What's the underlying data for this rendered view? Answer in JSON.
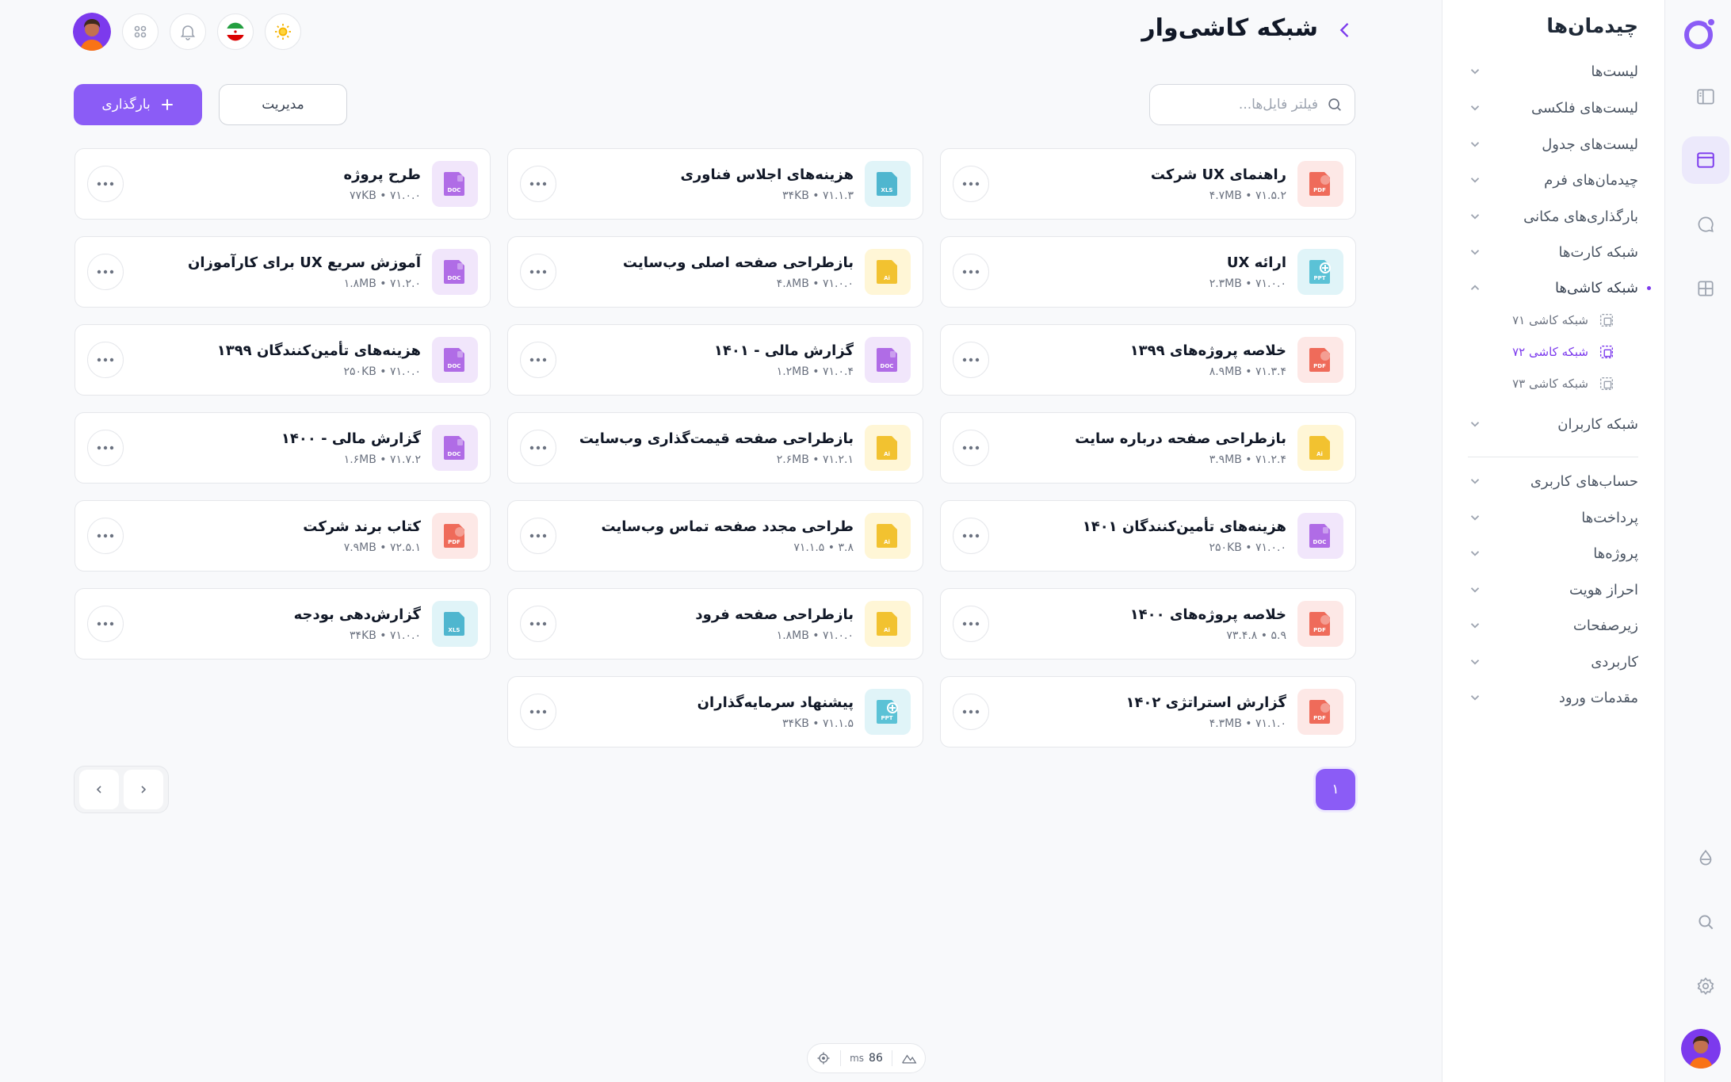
{
  "app": {
    "title": "شبکه کاشی‌وار"
  },
  "sidebar": {
    "title": "چیدمان‌ها",
    "items": [
      {
        "label": "لیست‌ها",
        "open": false
      },
      {
        "label": "لیست‌های فلکسی",
        "open": false
      },
      {
        "label": "لیست‌های جدول",
        "open": false
      },
      {
        "label": "چیدمان‌های فرم",
        "open": false
      },
      {
        "label": "بارگذاری‌های مکانی",
        "open": false
      },
      {
        "label": "شبکه کارت‌ها",
        "open": false
      },
      {
        "label": "شبکه کاشی‌ها",
        "open": true
      },
      {
        "label": "شبکه کاربران",
        "open": false
      }
    ],
    "subitems": [
      {
        "label": "شبکه کاشی ۷۱",
        "active": false
      },
      {
        "label": "شبکه کاشی ۷۲",
        "active": true
      },
      {
        "label": "شبکه کاشی ۷۳",
        "active": false
      }
    ],
    "items2": [
      {
        "label": "حساب‌های کاربری"
      },
      {
        "label": "پرداخت‌ها"
      },
      {
        "label": "پروژه‌ها"
      },
      {
        "label": "احراز هویت"
      },
      {
        "label": "زیرصفحات"
      },
      {
        "label": "کاربردی"
      },
      {
        "label": "مقدمات ورود"
      }
    ]
  },
  "toolbar": {
    "search_placeholder": "فیلتر فایل‌ها...",
    "upload_label": "بارگذاری",
    "manage_label": "مدیریت"
  },
  "files": [
    {
      "name": "راهنمای UX شرکت",
      "meta": "۴.۷MB • ۷۱.۵.۲",
      "type": "PDF"
    },
    {
      "name": "هزینه‌های اجلاس فناوری",
      "meta": "۳۴KB • ۷۱.۱.۳",
      "type": "XLS"
    },
    {
      "name": "طرح پروژه",
      "meta": "۷۷KB • ۷۱.۰.۰",
      "type": "DOC"
    },
    {
      "name": "ارائه UX",
      "meta": "۲.۳MB • ۷۱.۰.۰",
      "type": "PPT"
    },
    {
      "name": "بازطراحی صفحه اصلی وب‌سایت",
      "meta": "۴.۸MB • ۷۱.۰.۰",
      "type": "AI"
    },
    {
      "name": "آموزش سریع UX برای کارآموزان",
      "meta": "۱.۸MB • ۷۱.۲.۰",
      "type": "DOC"
    },
    {
      "name": "خلاصه پروژه‌های ۱۳۹۹",
      "meta": "۸.۹MB • ۷۱.۳.۴",
      "type": "PDF"
    },
    {
      "name": "گزارش مالی - ۱۴۰۱",
      "meta": "۱.۲MB • ۷۱.۰.۴",
      "type": "DOC"
    },
    {
      "name": "هزینه‌های تأمین‌کنندگان ۱۳۹۹",
      "meta": "۲۵۰KB • ۷۱.۰.۰",
      "type": "DOC"
    },
    {
      "name": "بازطراحی صفحه درباره سایت",
      "meta": "۳.۹MB • ۷۱.۲.۴",
      "type": "AI"
    },
    {
      "name": "بازطراحی صفحه قیمت‌گذاری وب‌سایت",
      "meta": "۲.۶MB • ۷۱.۲.۱",
      "type": "AI"
    },
    {
      "name": "گزارش مالی - ۱۴۰۰",
      "meta": "۱.۶MB • ۷۱.۷.۲",
      "type": "DOC"
    },
    {
      "name": "هزینه‌های تأمین‌کنندگان ۱۴۰۱",
      "meta": "۲۵۰KB • ۷۱.۰.۰",
      "type": "DOC"
    },
    {
      "name": "طراحی مجدد صفحه تماس وب‌سایت",
      "meta": "۳.۸ • ۷۱.۱.۵",
      "type": "AI"
    },
    {
      "name": "کتاب برند شرکت",
      "meta": "۷.۹MB • ۷۲.۵.۱",
      "type": "PDF"
    },
    {
      "name": "خلاصه پروژه‌های ۱۴۰۰",
      "meta": "۵.۹ • ۷۳.۴.۸",
      "type": "PDF"
    },
    {
      "name": "بازطراحی صفحه فرود",
      "meta": "۱.۸MB • ۷۱.۰.۰",
      "type": "AI"
    },
    {
      "name": "گزارش‌دهی بودجه",
      "meta": "۳۴KB • ۷۱.۰.۰",
      "type": "XLS"
    },
    {
      "name": "گزارش استراتژی ۱۴۰۲",
      "meta": "۴.۳MB • ۷۱.۱.۰",
      "type": "PDF"
    },
    {
      "name": "پیشنهاد سرمایه‌گذاران",
      "meta": "۳۴KB • ۷۱.۱.۵",
      "type": "PPT"
    }
  ],
  "pagination": {
    "current": "۱"
  },
  "perf": {
    "value": "86",
    "unit": "ms"
  },
  "colors": {
    "accent": "#8b5cf6",
    "pdf_bg": "#fde8e6",
    "pdf_fg": "#ef6b5a",
    "xls_bg": "#e0f4f8",
    "xls_fg": "#4fb6cf",
    "doc_bg": "#f1e6fb",
    "doc_fg": "#b06ce6",
    "ppt_bg": "#e0f4f8",
    "ppt_fg": "#5bc2d6",
    "ai_bg": "#fff6d6",
    "ai_fg": "#f2c230"
  }
}
